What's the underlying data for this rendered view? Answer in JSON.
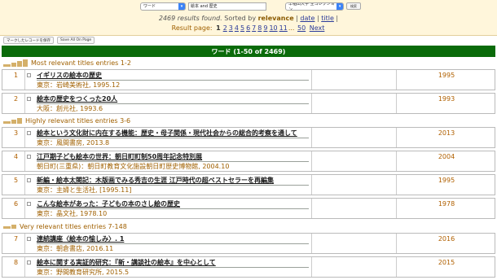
{
  "search": {
    "field_select": "ワード",
    "query": "絵本 and 歴史",
    "collection_select": "早稲田大学 全コレクション",
    "go_button": "検索"
  },
  "summary": {
    "count_text": "2469 results found.",
    "sorted_by_label": " Sorted by ",
    "sort_current": "relevance",
    "sep1": " | ",
    "sort_date": "date",
    "sep2": " | ",
    "sort_title": "title",
    "sep3": " |"
  },
  "pager": {
    "label": "Result page: ",
    "current": "1",
    "pages": [
      "2",
      "3",
      "4",
      "5",
      "6",
      "7",
      "8",
      "9",
      "10",
      "11"
    ],
    "ellipsis": "...",
    "last": "50",
    "next": "Next"
  },
  "toolbar": {
    "save_marked": "マークしたレコードを保存",
    "save_all": "Save All On Page"
  },
  "table_header": "ワード (1-50 of 2469)",
  "groups": [
    {
      "label": "Most relevant titles entries 1-2"
    },
    {
      "label": "Highly relevant titles entries 3-6"
    },
    {
      "label": "Very relevant titles entries 7-148"
    }
  ],
  "rows": [
    {
      "num": "1",
      "title": "イギリスの絵本の歴史",
      "publisher": "東京：岩崎美術社, 1995.12",
      "year": "1995"
    },
    {
      "num": "2",
      "title": "絵本の歴史をつくった20人",
      "publisher": "大阪：創元社, 1993.6",
      "year": "1993"
    },
    {
      "num": "3",
      "title": "絵本という文化財に内在する機能：歴史・母子関係・現代社会からの総合的考察を通して",
      "publisher": "東京：風間書房, 2013.8",
      "year": "2013"
    },
    {
      "num": "4",
      "title": "江戸期子ども絵本の世界：朝日町町制50周年記念特別展",
      "publisher": "朝日町(三重県)：朝日町教育文化施設朝日町歴史博物館, 2004.10",
      "year": "2004"
    },
    {
      "num": "5",
      "title": "新編・絵本太閤記：木版画でみる秀吉の生涯 江戸時代の超ベストセラーを再編集",
      "publisher": "東京：主婦と生活社, [1995.11]",
      "year": "1995"
    },
    {
      "num": "6",
      "title": "こんな絵本があった：子どもの本のさし絵の歴史",
      "publisher": "東京：晶文社, 1978.10",
      "year": "1978"
    },
    {
      "num": "7",
      "title": "連続講座〈絵本の愉しみ〉. 1",
      "publisher": "東京：朝倉書店, 2016.11",
      "year": "2016"
    },
    {
      "num": "8",
      "title": "絵本に関する実証的研究：『新・講談社の絵本』を中心として",
      "publisher": "東京：野間教育研究所, 2015.5",
      "year": "2015"
    }
  ]
}
